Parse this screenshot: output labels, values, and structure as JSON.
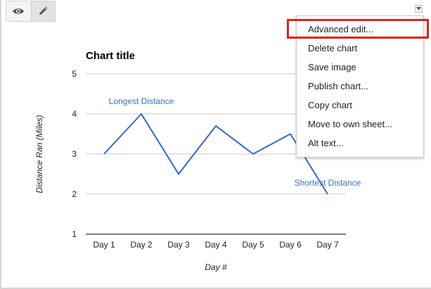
{
  "toolbar": {
    "view_icon": "eye-icon",
    "edit_icon": "pencil-icon",
    "menu_icon": "triangle-down-icon"
  },
  "menu": {
    "items": [
      "Advanced edit...",
      "Delete chart",
      "Save image",
      "Publish chart...",
      "Copy chart",
      "Move to own sheet...",
      "Alt text..."
    ],
    "highlighted_item": "Advanced edit...",
    "highlight_color": "#e0211f"
  },
  "chart_data": {
    "type": "line",
    "title": "Chart title",
    "xlabel": "Day #",
    "ylabel": "Distance Ran (Miles)",
    "categories": [
      "Day 1",
      "Day 2",
      "Day 3",
      "Day 4",
      "Day 5",
      "Day 6",
      "Day 7"
    ],
    "series": [
      {
        "values": [
          3,
          4,
          2.5,
          3.7,
          3,
          3.5,
          2
        ],
        "color": "#3366cc"
      }
    ],
    "ylim": [
      1,
      5
    ],
    "yticks": [
      1,
      2,
      3,
      4,
      5
    ],
    "annotations": [
      {
        "category_index": 1,
        "text": "Longest Distance"
      },
      {
        "category_index": 6,
        "text": "Shortest Distance"
      }
    ],
    "gridlines": true,
    "legend": "none"
  }
}
